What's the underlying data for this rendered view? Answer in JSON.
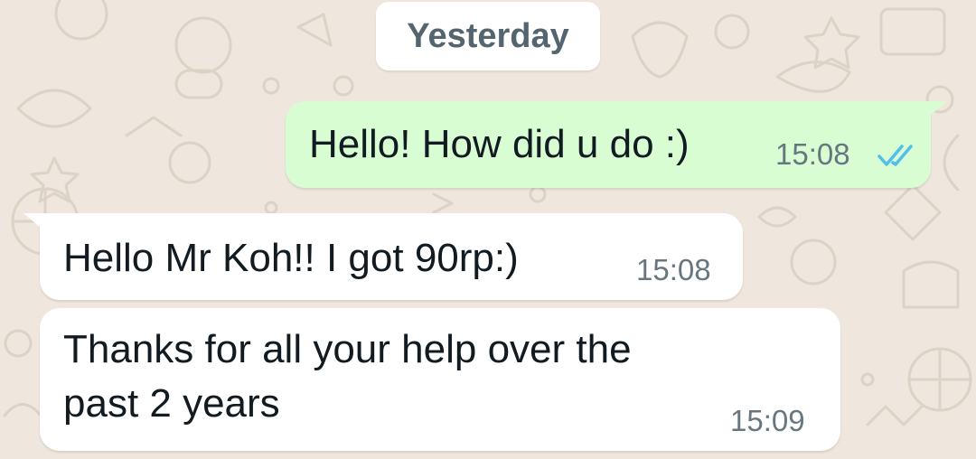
{
  "chat": {
    "date_label": "Yesterday",
    "messages": [
      {
        "direction": "outgoing",
        "text": "Hello! How did u do :)",
        "time": "15:08",
        "status": "read"
      },
      {
        "direction": "incoming",
        "text": "Hello Mr Koh!! I got 90rp:)",
        "time": "15:08"
      },
      {
        "direction": "incoming",
        "text": "Thanks for all your help over the\npast 2 years",
        "time": "15:09"
      }
    ]
  },
  "colors": {
    "background": "#efe7dd",
    "outgoing_bubble": "#d9fdd3",
    "incoming_bubble": "#ffffff",
    "read_ticks": "#53bdeb",
    "timestamp": "#667781"
  },
  "icons": {
    "read_receipt": "double-check-icon"
  }
}
